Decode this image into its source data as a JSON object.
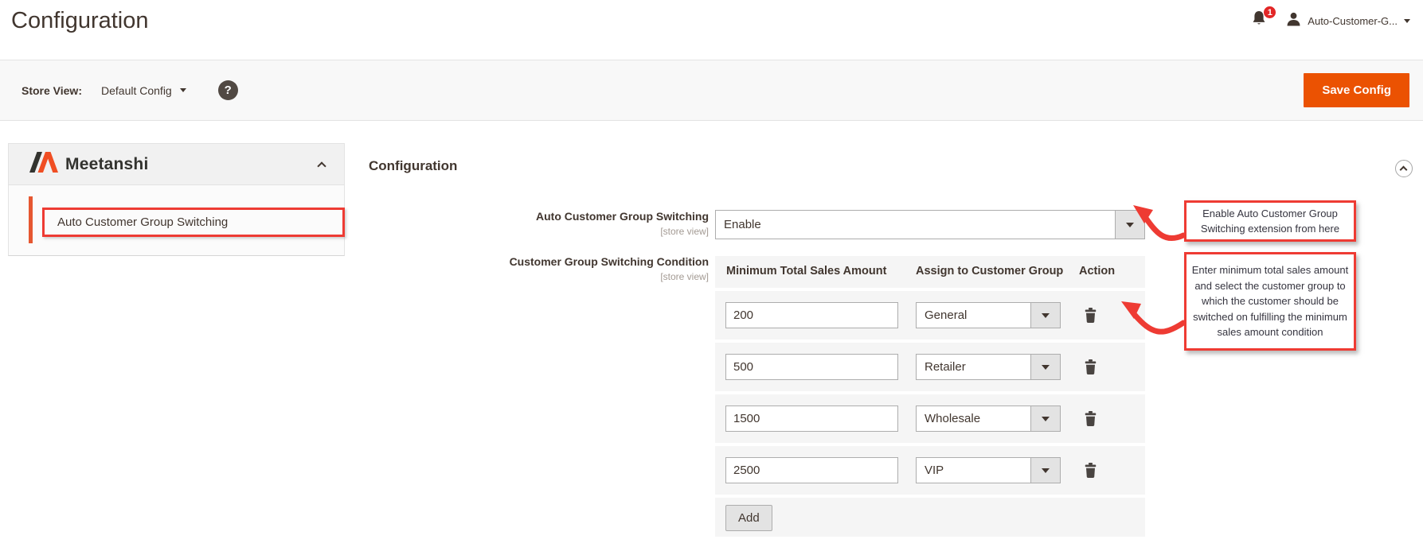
{
  "page": {
    "title": "Configuration"
  },
  "header": {
    "notification_count": "1",
    "username": "Auto-Customer-G..."
  },
  "toolbar": {
    "store_view_label": "Store View:",
    "store_view_value": "Default Config",
    "help_glyph": "?",
    "save_label": "Save Config"
  },
  "sidebar": {
    "brand": "Meetanshi",
    "items": [
      {
        "label": "Auto Customer Group Switching",
        "active": true,
        "highlighted": true
      }
    ]
  },
  "main": {
    "section_title": "Configuration",
    "fields": [
      {
        "label": "Auto Customer Group Switching",
        "scope": "[store view]",
        "value": "Enable"
      },
      {
        "label": "Customer Group Switching Condition",
        "scope": "[store view]"
      }
    ],
    "table": {
      "columns": [
        "Minimum Total Sales Amount",
        "Assign to Customer Group",
        "Action"
      ],
      "rows": [
        {
          "amount": "200",
          "group": "General"
        },
        {
          "amount": "500",
          "group": "Retailer"
        },
        {
          "amount": "1500",
          "group": "Wholesale"
        },
        {
          "amount": "2500",
          "group": "VIP"
        }
      ],
      "add_label": "Add"
    }
  },
  "annotations": [
    {
      "text": "Enable Auto Customer Group Switching extension from here"
    },
    {
      "text": "Enter minimum total sales amount and select the customer group to which the customer should be switched on fulfilling the minimum sales amount condition"
    }
  ],
  "colors": {
    "accent_orange": "#eb5202",
    "logo_orange": "#f04e23",
    "annotation_red": "#ee3b33",
    "badge_red": "#e22626",
    "text_dark": "#41362f",
    "panel_gray": "#f5f5f5"
  }
}
